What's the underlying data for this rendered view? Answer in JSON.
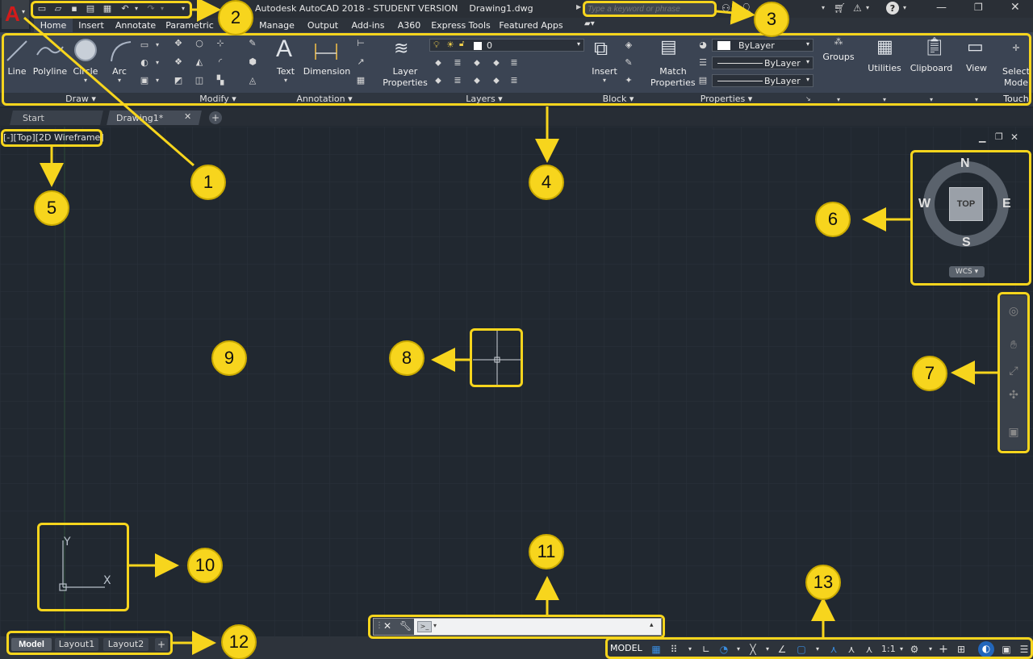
{
  "window": {
    "title": "Autodesk AutoCAD 2018 - STUDENT VERSION    Drawing1.dwg",
    "search_placeholder": "Type a keyword or phrase"
  },
  "ribbon_tabs": [
    "Home",
    "Insert",
    "Annotate",
    "Parametric",
    "Manage",
    "Output",
    "Add-ins",
    "A360",
    "Express Tools",
    "Featured Apps"
  ],
  "draw": {
    "line": "Line",
    "polyline": "Polyline",
    "circle": "Circle",
    "arc": "Arc",
    "title": "Draw"
  },
  "modify": {
    "title": "Modify"
  },
  "annotation": {
    "text": "Text",
    "dimension": "Dimension",
    "title": "Annotation"
  },
  "layers": {
    "layer_properties_1": "Layer",
    "layer_properties_2": "Properties",
    "current_layer": "0",
    "title": "Layers"
  },
  "block": {
    "insert": "Insert",
    "title": "Block"
  },
  "properties": {
    "match_1": "Match",
    "match_2": "Properties",
    "color": "ByLayer",
    "linetype": "ByLayer",
    "lineweight": "ByLayer",
    "title": "Properties"
  },
  "groups": {
    "label": "Groups"
  },
  "utilities": {
    "label": "Utilities"
  },
  "clipboard": {
    "label": "Clipboard"
  },
  "view": {
    "label": "View"
  },
  "touch": {
    "select_1": "Select",
    "select_2": "Mode",
    "title": "Touch"
  },
  "file_tabs": {
    "start": "Start",
    "drawing": "Drawing1*"
  },
  "viewport": {
    "controls": "[-][Top][2D Wireframe]"
  },
  "viewcube": {
    "n": "N",
    "s": "S",
    "e": "E",
    "w": "W",
    "face": "TOP",
    "wcs": "WCS"
  },
  "ucs": {
    "x": "X",
    "y": "Y"
  },
  "layout_tabs": [
    "Model",
    "Layout1",
    "Layout2"
  ],
  "status": {
    "model": "MODEL",
    "scale": "1:1"
  },
  "callouts": [
    "1",
    "2",
    "3",
    "4",
    "5",
    "6",
    "7",
    "8",
    "9",
    "10",
    "11",
    "12",
    "13"
  ],
  "colors": {
    "accent": "#f7d51d",
    "bg": "#212830",
    "ribbon": "#3b4453",
    "title": "#2d333b"
  }
}
